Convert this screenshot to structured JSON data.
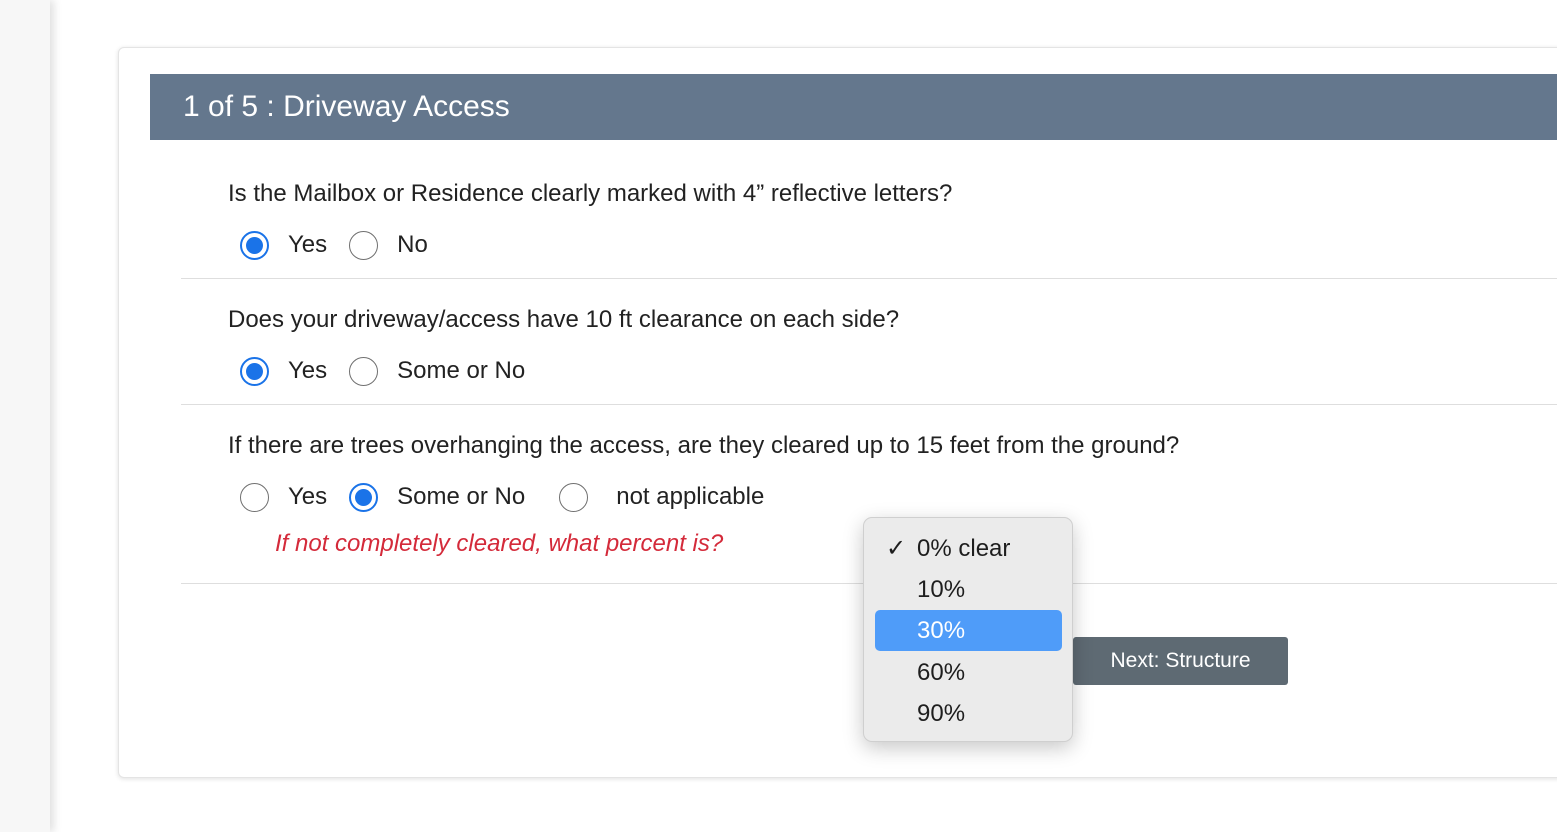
{
  "section": {
    "title": "1 of 5 : Driveway Access"
  },
  "questions": [
    {
      "text": "Is the Mailbox or Residence clearly marked with 4” reflective letters?",
      "options": [
        {
          "label": "Yes",
          "checked": true
        },
        {
          "label": "No",
          "checked": false
        }
      ]
    },
    {
      "text": "Does your driveway/access have 10 ft clearance on each side?",
      "options": [
        {
          "label": "Yes",
          "checked": true
        },
        {
          "label": "Some or No",
          "checked": false
        }
      ]
    },
    {
      "text": "If there are trees overhanging the access, are they cleared up to 15 feet from the ground?",
      "options": [
        {
          "label": "Yes",
          "checked": false
        },
        {
          "label": "Some or No",
          "checked": true
        },
        {
          "label": "not applicable",
          "checked": false
        }
      ],
      "followup_prompt": "If not completely cleared, what percent is?"
    }
  ],
  "percent_dropdown": {
    "selected": "0% clear",
    "highlighted": "30%",
    "check_mark": "✓",
    "options": [
      "0% clear",
      "10%",
      "30%",
      "60%",
      "90%"
    ]
  },
  "navigation": {
    "next_label": "Next: Structure"
  },
  "colors": {
    "header_bg": "#64778d",
    "radio_accent": "#1a73e8",
    "prompt_text": "#d42a3a",
    "button_bg": "#5e6a73",
    "dropdown_highlight": "#4f9cf9"
  }
}
